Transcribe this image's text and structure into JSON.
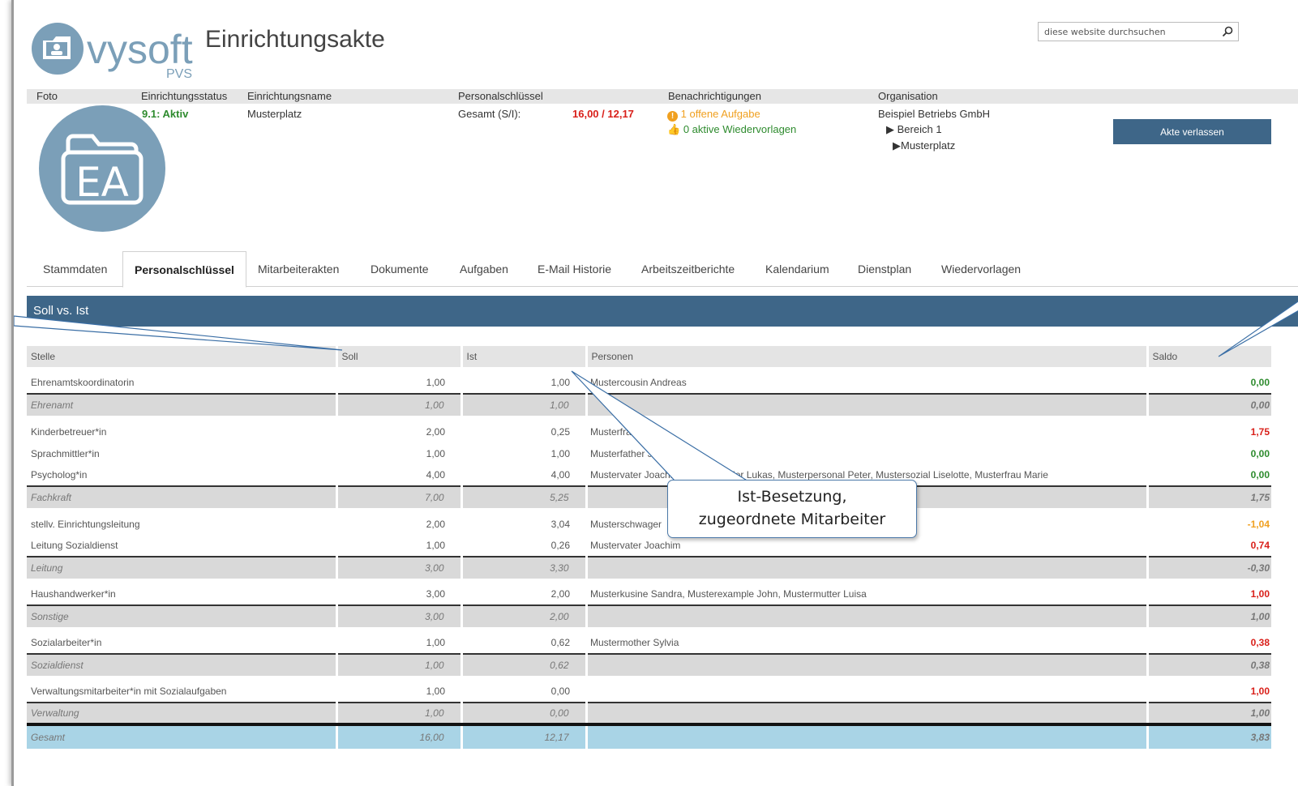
{
  "header": {
    "logo_text": "vysoft",
    "logo_sub": "PVS",
    "title": "Einrichtungsakte",
    "search_placeholder": "diese website durchsuchen"
  },
  "info": {
    "headers": {
      "foto": "Foto",
      "status": "Einrichtungsstatus",
      "name": "Einrichtungsname",
      "key": "Personalschlüssel",
      "notifications": "Benachrichtigungen",
      "org": "Organisation"
    },
    "status": "9.1: Aktiv",
    "name": "Musterplatz",
    "key_label": "Gesamt (S/I):",
    "key_value": "16,00 / 12,17",
    "notif_tasks": "1 offene Aufgabe",
    "notif_reminders": "0 aktive Wiedervorlagen",
    "org_company": "Beispiel Betriebs GmbH",
    "org_area": "Bereich 1",
    "org_place": "Musterplatz",
    "avatar_text": "EA",
    "leave_button": "Akte verlassen"
  },
  "tabs": [
    {
      "label": "Stammdaten"
    },
    {
      "label": "Personalschlüssel",
      "active": true
    },
    {
      "label": "Mitarbeiterakten"
    },
    {
      "label": "Dokumente"
    },
    {
      "label": "Aufgaben"
    },
    {
      "label": "E-Mail Historie"
    },
    {
      "label": "Arbeitszeitberichte"
    },
    {
      "label": "Kalendarium"
    },
    {
      "label": "Dienstplan"
    },
    {
      "label": "Wiedervorlagen"
    }
  ],
  "section_title": "Soll vs. Ist",
  "table": {
    "columns": [
      "Stelle",
      "Soll",
      "Ist",
      "Personen",
      "Saldo"
    ],
    "rows": [
      {
        "type": "row",
        "stelle": "Ehrenamtskoordinatorin",
        "soll": "1,00",
        "ist": "1,00",
        "personen": "Mustercousin Andreas",
        "saldo": "0,00",
        "tone": "zero",
        "first": true
      },
      {
        "type": "sub",
        "stelle": "Ehrenamt",
        "soll": "1,00",
        "ist": "1,00",
        "personen": "",
        "saldo": "0,00",
        "tone": "zero"
      },
      {
        "type": "row",
        "stelle": "Kinderbetreuer*in",
        "soll": "2,00",
        "ist": "0,25",
        "personen": "Musterfrau M",
        "saldo": "1,75",
        "tone": "pos",
        "first": true
      },
      {
        "type": "row",
        "stelle": "Sprachmittler*in",
        "soll": "1,00",
        "ist": "1,00",
        "personen": "Musterfather Jim",
        "saldo": "0,00",
        "tone": "zero"
      },
      {
        "type": "row",
        "stelle": "Psycholog*in",
        "soll": "4,00",
        "ist": "4,00",
        "personen": "Mustervater Joachim, Musterbruder Lukas, Musterpersonal Peter, Mustersozial Liselotte, Musterfrau Marie",
        "saldo": "0,00",
        "tone": "zero"
      },
      {
        "type": "sub",
        "stelle": "Fachkraft",
        "soll": "7,00",
        "ist": "5,25",
        "personen": "",
        "saldo": "1,75",
        "tone": "pos"
      },
      {
        "type": "row",
        "stelle": "stellv. Einrichtungsleitung",
        "soll": "2,00",
        "ist": "3,04",
        "personen": "Musterschwager",
        "saldo": "-1,04",
        "tone": "neg",
        "first": true
      },
      {
        "type": "row",
        "stelle": "Leitung Sozialdienst",
        "soll": "1,00",
        "ist": "0,26",
        "personen": "Mustervater Joachim",
        "saldo": "0,74",
        "tone": "pos"
      },
      {
        "type": "sub",
        "stelle": "Leitung",
        "soll": "3,00",
        "ist": "3,30",
        "personen": "",
        "saldo": "-0,30",
        "tone": "neg"
      },
      {
        "type": "row",
        "stelle": "Haushandwerker*in",
        "soll": "3,00",
        "ist": "2,00",
        "personen": "Musterkusine Sandra, Musterexample John, Mustermutter Luisa",
        "saldo": "1,00",
        "tone": "pos",
        "first": true
      },
      {
        "type": "sub",
        "stelle": "Sonstige",
        "soll": "3,00",
        "ist": "2,00",
        "personen": "",
        "saldo": "1,00",
        "tone": "pos"
      },
      {
        "type": "row",
        "stelle": "Sozialarbeiter*in",
        "soll": "1,00",
        "ist": "0,62",
        "personen": "Mustermother Sylvia",
        "saldo": "0,38",
        "tone": "pos",
        "first": true
      },
      {
        "type": "sub",
        "stelle": "Sozialdienst",
        "soll": "1,00",
        "ist": "0,62",
        "personen": "",
        "saldo": "0,38",
        "tone": "pos"
      },
      {
        "type": "row",
        "stelle": "Verwaltungsmitarbeiter*in mit Sozialaufgaben",
        "soll": "1,00",
        "ist": "0,00",
        "personen": "",
        "saldo": "1,00",
        "tone": "pos",
        "first": true
      },
      {
        "type": "sub",
        "stelle": "Verwaltung",
        "soll": "1,00",
        "ist": "0,00",
        "personen": "",
        "saldo": "1,00",
        "tone": "pos"
      },
      {
        "type": "total",
        "stelle": "Gesamt",
        "soll": "16,00",
        "ist": "12,17",
        "personen": "",
        "saldo": "3,83",
        "tone": "pos"
      }
    ]
  },
  "callout": {
    "line1": "Ist-Besetzung,",
    "line2": "zugeordnete Mitarbeiter"
  },
  "colors": {
    "accent": "#3e6688",
    "avatar": "#7b9fb8",
    "positive_saldo": "#d9201a",
    "zero_saldo": "#2e8b2e",
    "negative_saldo": "#f0a020",
    "total_row": "#a9d4e6"
  }
}
